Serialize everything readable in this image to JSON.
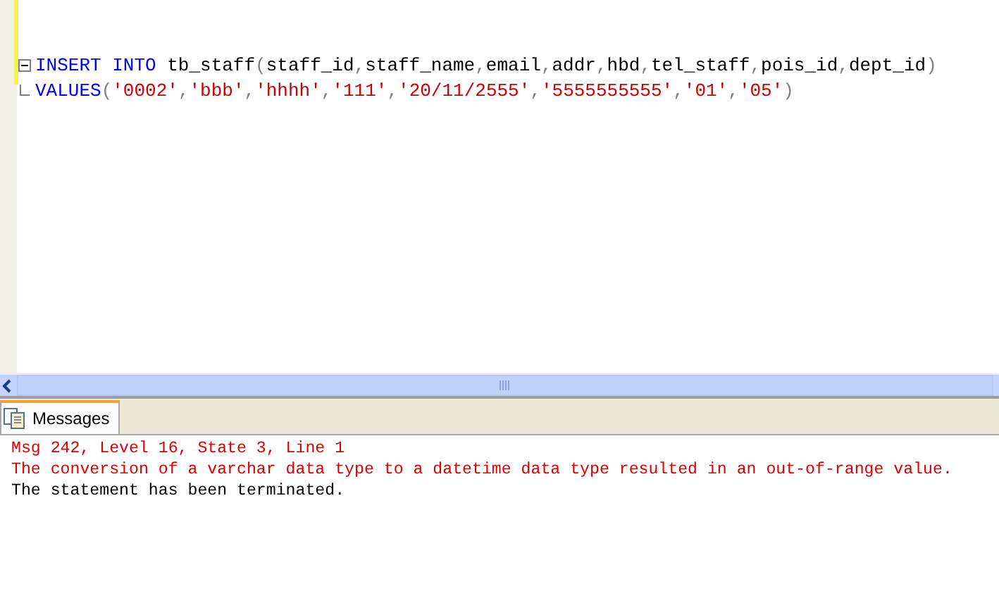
{
  "editor": {
    "lines": [
      {
        "kind": "fold-start",
        "tokens": [
          {
            "kind": "keyword",
            "text": "INSERT INTO"
          },
          {
            "kind": "plain",
            "text": " tb_staff"
          },
          {
            "kind": "punct",
            "text": "("
          },
          {
            "kind": "plain",
            "text": "staff_id"
          },
          {
            "kind": "punct",
            "text": ","
          },
          {
            "kind": "plain",
            "text": "staff_name"
          },
          {
            "kind": "punct",
            "text": ","
          },
          {
            "kind": "plain",
            "text": "email"
          },
          {
            "kind": "punct",
            "text": ","
          },
          {
            "kind": "plain",
            "text": "addr"
          },
          {
            "kind": "punct",
            "text": ","
          },
          {
            "kind": "plain",
            "text": "hbd"
          },
          {
            "kind": "punct",
            "text": ","
          },
          {
            "kind": "plain",
            "text": "tel_staff"
          },
          {
            "kind": "punct",
            "text": ","
          },
          {
            "kind": "plain",
            "text": "pois_id"
          },
          {
            "kind": "punct",
            "text": ","
          },
          {
            "kind": "plain",
            "text": "dept_id"
          },
          {
            "kind": "punct",
            "text": ")"
          }
        ]
      },
      {
        "kind": "fold-end",
        "tokens": [
          {
            "kind": "keyword",
            "text": "VALUES"
          },
          {
            "kind": "punct",
            "text": "("
          },
          {
            "kind": "string",
            "text": "'0002'"
          },
          {
            "kind": "punct",
            "text": ","
          },
          {
            "kind": "string",
            "text": "'bbb'"
          },
          {
            "kind": "punct",
            "text": ","
          },
          {
            "kind": "string",
            "text": "'hhhh'"
          },
          {
            "kind": "punct",
            "text": ","
          },
          {
            "kind": "string",
            "text": "'111'"
          },
          {
            "kind": "punct",
            "text": ","
          },
          {
            "kind": "string",
            "text": "'20/11/2555'"
          },
          {
            "kind": "punct",
            "text": ","
          },
          {
            "kind": "string",
            "text": "'5555555555'"
          },
          {
            "kind": "punct",
            "text": ","
          },
          {
            "kind": "string",
            "text": "'01'"
          },
          {
            "kind": "punct",
            "text": ","
          },
          {
            "kind": "string",
            "text": "'05'"
          },
          {
            "kind": "punct",
            "text": ")"
          }
        ]
      }
    ]
  },
  "results": {
    "tabs": [
      {
        "label": "Messages",
        "selected": true
      }
    ],
    "messages": [
      {
        "kind": "error",
        "text": "Msg 242, Level 16, State 3, Line 1"
      },
      {
        "kind": "error",
        "text": "The conversion of a varchar data type to a datetime data type resulted in an out-of-range value."
      },
      {
        "kind": "info",
        "text": "The statement has been terminated."
      }
    ]
  }
}
